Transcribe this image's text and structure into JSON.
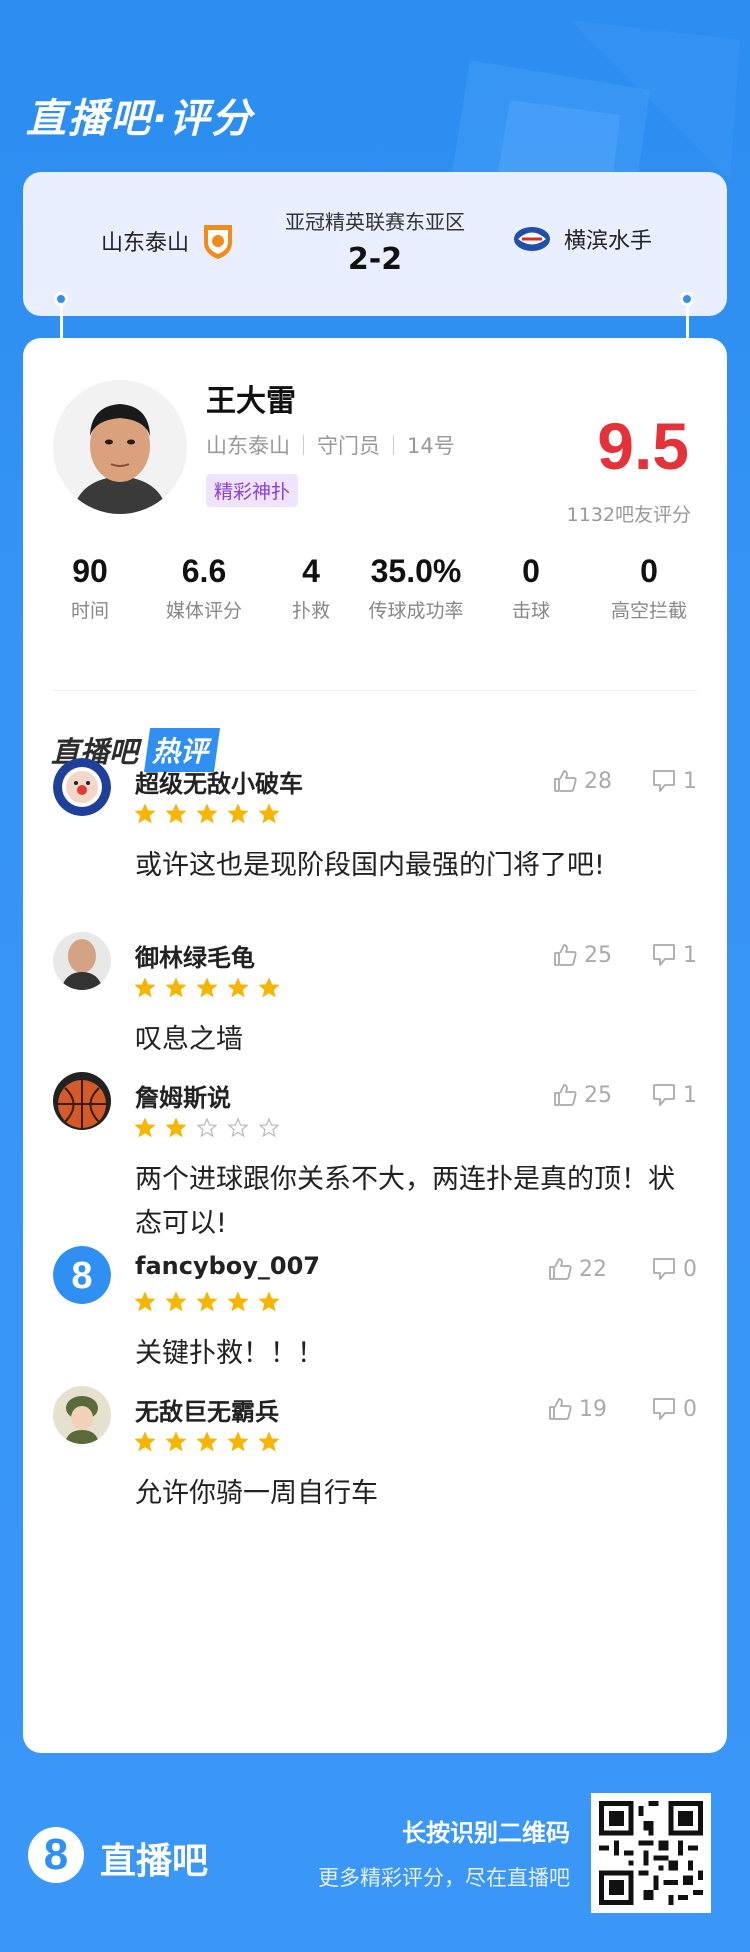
{
  "header": {
    "title": "直播吧·评分"
  },
  "match": {
    "league": "亚冠精英联赛东亚区",
    "score": "2-2",
    "home_team": "山东泰山",
    "away_team": "横滨水手"
  },
  "player": {
    "name": "王大雷",
    "team": "山东泰山",
    "position": "守门员",
    "number": "14号",
    "tag": "精彩神扑",
    "rating": "9.5",
    "rating_count": "1132吧友评分"
  },
  "stats": [
    {
      "value": "90",
      "label": "时间"
    },
    {
      "value": "6.6",
      "label": "媒体评分"
    },
    {
      "value": "4",
      "label": "扑救"
    },
    {
      "value": "35.0%",
      "label": "传球成功率"
    },
    {
      "value": "0",
      "label": "击球"
    },
    {
      "value": "0",
      "label": "高空拦截"
    }
  ],
  "hot_section": {
    "label_left": "直播吧",
    "label_right": "热评"
  },
  "comments": [
    {
      "user": "超级无敌小破车",
      "stars": 5,
      "likes": "28",
      "dislikes": "1",
      "text": "或许这也是现阶段国内最强的门将了吧!"
    },
    {
      "user": "御林绿毛龟",
      "stars": 5,
      "likes": "25",
      "dislikes": "1",
      "text": "叹息之墙"
    },
    {
      "user": "詹姆斯说",
      "stars": 2,
      "likes": "25",
      "dislikes": "1",
      "text": "两个进球跟你关系不大，两连扑是真的顶！状态可以!"
    },
    {
      "user": "fancyboy_007",
      "stars": 5,
      "likes": "22",
      "dislikes": "0",
      "text": "关键扑救！！！"
    },
    {
      "user": "无敌巨无霸兵",
      "stars": 5,
      "likes": "19",
      "dislikes": "0",
      "text": "允许你骑一周自行车"
    }
  ],
  "footer": {
    "logo_glyph": "8",
    "brand": "直播吧",
    "line1": "长按识别二维码",
    "line2": "更多精彩评分，尽在直播吧"
  },
  "colors": {
    "primary": "#2f8ff2",
    "rating": "#e53238",
    "star": "#f7b500"
  }
}
